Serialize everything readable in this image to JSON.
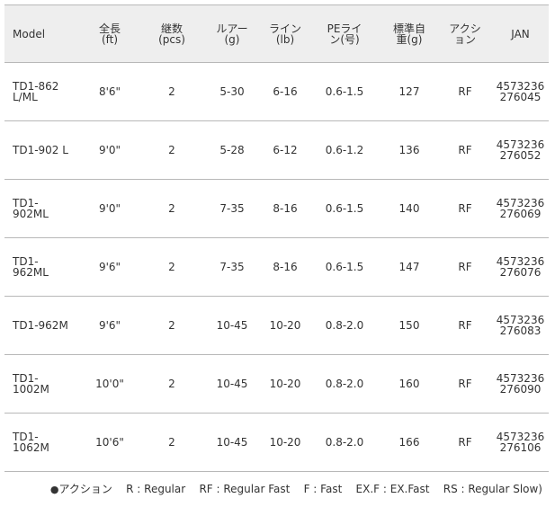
{
  "headers": [
    {
      "lines": [
        "Model"
      ]
    },
    {
      "lines": [
        "全長",
        "(ft)"
      ]
    },
    {
      "lines": [
        "継数",
        "(pcs)"
      ]
    },
    {
      "lines": [
        "ルアー",
        "(g)"
      ]
    },
    {
      "lines": [
        "ライン",
        "(lb)"
      ]
    },
    {
      "lines": [
        "PEライ",
        "ン(号)"
      ]
    },
    {
      "lines": [
        "標準自",
        "重(g)"
      ]
    },
    {
      "lines": [
        "アクシ",
        "ョン"
      ]
    },
    {
      "lines": [
        "JAN"
      ]
    }
  ],
  "rows": [
    {
      "model": [
        "TD1-862",
        "L/ML"
      ],
      "length": "8'6\"",
      "pcs": "2",
      "lure": "5-30",
      "line": "6-16",
      "pe": "0.6-1.5",
      "weight": "127",
      "action": "RF",
      "jan": [
        "4573236",
        "276045"
      ]
    },
    {
      "model": [
        "TD1-902 L"
      ],
      "length": "9'0\"",
      "pcs": "2",
      "lure": "5-28",
      "line": "6-12",
      "pe": "0.6-1.2",
      "weight": "136",
      "action": "RF",
      "jan": [
        "4573236",
        "276052"
      ]
    },
    {
      "model": [
        "TD1-",
        "902ML"
      ],
      "length": "9'0\"",
      "pcs": "2",
      "lure": "7-35",
      "line": "8-16",
      "pe": "0.6-1.5",
      "weight": "140",
      "action": "RF",
      "jan": [
        "4573236",
        "276069"
      ]
    },
    {
      "model": [
        "TD1-",
        "962ML"
      ],
      "length": "9'6\"",
      "pcs": "2",
      "lure": "7-35",
      "line": "8-16",
      "pe": "0.6-1.5",
      "weight": "147",
      "action": "RF",
      "jan": [
        "4573236",
        "276076"
      ]
    },
    {
      "model": [
        "TD1-962M"
      ],
      "length": "9'6\"",
      "pcs": "2",
      "lure": "10-45",
      "line": "10-20",
      "pe": "0.8-2.0",
      "weight": "150",
      "action": "RF",
      "jan": [
        "4573236",
        "276083"
      ]
    },
    {
      "model": [
        "TD1-",
        "1002M"
      ],
      "length": "10'0\"",
      "pcs": "2",
      "lure": "10-45",
      "line": "10-20",
      "pe": "0.8-2.0",
      "weight": "160",
      "action": "RF",
      "jan": [
        "4573236",
        "276090"
      ]
    },
    {
      "model": [
        "TD1-",
        "1062M"
      ],
      "length": "10'6\"",
      "pcs": "2",
      "lure": "10-45",
      "line": "10-20",
      "pe": "0.8-2.0",
      "weight": "166",
      "action": "RF",
      "jan": [
        "4573236",
        "276106"
      ]
    }
  ],
  "legend": {
    "bullet": "●",
    "label": "アクション",
    "items": [
      "R : Regular",
      "RF : Regular Fast",
      "F : Fast",
      "EX.F : EX.Fast",
      "RS : Regular Slow)"
    ]
  },
  "colors": {
    "header_bg": "#eeeeee",
    "border": "#b8b8b8",
    "text": "#333333"
  }
}
